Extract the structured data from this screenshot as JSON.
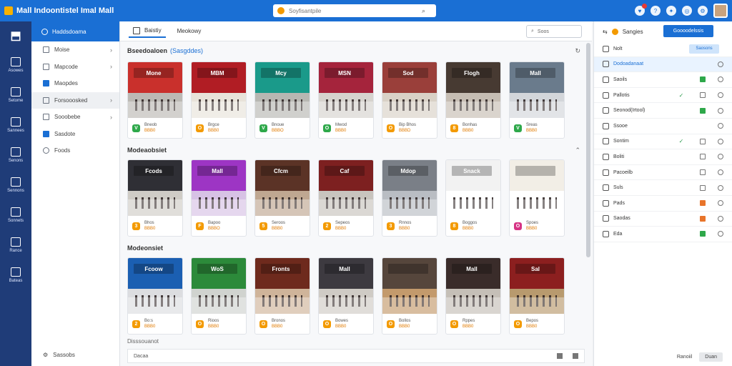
{
  "app": {
    "title": "Mall Indoontistel Imal Mall"
  },
  "search": {
    "placeholder": "Soyfisantpile"
  },
  "sidebar": {
    "header": "Haddsdoama",
    "items": [
      {
        "label": "Moise",
        "chevron": true
      },
      {
        "label": "Mapcode",
        "chevron": true
      },
      {
        "label": "Maopdes",
        "chevron": false
      },
      {
        "label": "Forsooosked",
        "chevron": true
      },
      {
        "label": "Sooobebe",
        "chevron": true
      },
      {
        "label": "Sasdote",
        "chevron": false
      },
      {
        "label": "Foods",
        "chevron": false
      }
    ],
    "footer": "Sassobs"
  },
  "rail": {
    "items": [
      "Asowes",
      "Setome",
      "Sannees",
      "Senons",
      "Sennons",
      "Sonnets",
      "Rance",
      "Bateas"
    ]
  },
  "tabs": [
    {
      "label": "Baistiy"
    },
    {
      "label": "Meokowy"
    }
  ],
  "main_search": {
    "placeholder": "Soos"
  },
  "sections": [
    {
      "title": "Bseedoaloen",
      "tag": "(Sasgddes)",
      "cards": [
        {
          "sign": "Mone",
          "line1": "Bneob",
          "line2": "BBB0",
          "badge": "V",
          "badge_color": "#2ea84a",
          "wall": "#c9302c",
          "floor": "#bcb9b4"
        },
        {
          "sign": "MBM",
          "line1": "Brgce",
          "line2": "BBB0",
          "badge": "O",
          "badge_color": "#f39a00",
          "wall": "#b11d24",
          "floor": "#e8e3da"
        },
        {
          "sign": "Mcy",
          "line1": "Bnoue",
          "line2": "BBBO",
          "badge": "V",
          "badge_color": "#2ea84a",
          "wall": "#1a9a8a",
          "floor": "#b7b7b2"
        },
        {
          "sign": "MSN",
          "line1": "Mwod",
          "line2": "BBB0",
          "badge": "O",
          "badge_color": "#2ea84a",
          "wall": "#a5243c",
          "floor": "#d6d3ce"
        },
        {
          "sign": "Sod",
          "line1": "Bip Bhos",
          "line2": "BBBD",
          "badge": "O",
          "badge_color": "#f39a00",
          "wall": "#9a3f3a",
          "floor": "#d9d1c6"
        },
        {
          "sign": "Flogh",
          "line1": "Bonhas",
          "line2": "BBB0",
          "badge": "8",
          "badge_color": "#f39a00",
          "wall": "#473a32",
          "floor": "#c6bdb3"
        },
        {
          "sign": "Mall",
          "line1": "Sreas",
          "line2": "BBB0",
          "badge": "V",
          "badge_color": "#2ea84a",
          "wall": "#6a7b8c",
          "floor": "#d3d6da"
        }
      ]
    },
    {
      "title": "Modeaobsiet",
      "tag": "",
      "cards": [
        {
          "sign": "Fcods",
          "line1": "Bhos",
          "line2": "BBB0",
          "badge": "3",
          "badge_color": "#f39a00",
          "wall": "#2f2f35",
          "floor": "#cfccc6"
        },
        {
          "sign": "Mall",
          "line1": "Bapoo",
          "line2": "BBBO",
          "badge": "F",
          "badge_color": "#f39a00",
          "wall": "#9d35c4",
          "floor": "#d7c2e5"
        },
        {
          "sign": "Cfcm",
          "line1": "Seroos",
          "line2": "BBB0",
          "badge": "5",
          "badge_color": "#f39a00",
          "wall": "#5b3326",
          "floor": "#bfa791"
        },
        {
          "sign": "Caf",
          "line1": "Sepeos",
          "line2": "BBB0",
          "badge": "2",
          "badge_color": "#f39a00",
          "wall": "#7d2020",
          "floor": "#c8c4be"
        },
        {
          "sign": "Mdop",
          "line1": "Rnnos",
          "line2": "BBB0",
          "badge": "3",
          "badge_color": "#f39a00",
          "wall": "#7a7f87",
          "floor": "#b9bdc3"
        },
        {
          "sign": "Snack",
          "line1": "Boggos",
          "line2": "BBB0",
          "badge": "8",
          "badge_color": "#f39a00",
          "wall": "#f2f2f2",
          "floor": "#ffffff"
        },
        {
          "sign": "",
          "line1": "Spoes",
          "line2": "BBB0",
          "badge": "O",
          "badge_color": "#d63384",
          "wall": "#f2eee6",
          "floor": "#ffffff"
        }
      ]
    },
    {
      "title": "Modeonsiet",
      "tag": "",
      "cards": [
        {
          "sign": "Fcoow",
          "line1": "Bo:s",
          "line2": "BBB0",
          "badge": "2",
          "badge_color": "#f39a00",
          "wall": "#1b5fb2",
          "floor": "#dcdde0"
        },
        {
          "sign": "WoS",
          "line1": "Rioos",
          "line2": "BBB0",
          "badge": "O",
          "badge_color": "#f39a00",
          "wall": "#2c8a3a",
          "floor": "#d0d3cf"
        },
        {
          "sign": "Fronts",
          "line1": "Bronos",
          "line2": "BBB0",
          "badge": "O",
          "badge_color": "#f39a00",
          "wall": "#6e2a1d",
          "floor": "#cfb49a"
        },
        {
          "sign": "Mall",
          "line1": "Bowes",
          "line2": "BBB0",
          "badge": "O",
          "badge_color": "#f39a00",
          "wall": "#3d3a40",
          "floor": "#cfcbc5"
        },
        {
          "sign": "",
          "line1": "Bollos",
          "line2": "BBB0",
          "badge": "O",
          "badge_color": "#f39a00",
          "wall": "#56463c",
          "floor": "#c39a6c"
        },
        {
          "sign": "Mall",
          "line1": "Rppes",
          "line2": "BBB0",
          "badge": "O",
          "badge_color": "#f39a00",
          "wall": "#3a2c2a",
          "floor": "#c5bfb7"
        },
        {
          "sign": "Sal",
          "line1": "Bepos",
          "line2": "BBB0",
          "badge": "O",
          "badge_color": "#f39a00",
          "wall": "#8c1f1f",
          "floor": "#b89a6e"
        }
      ]
    }
  ],
  "bottom_bar": {
    "label": "Dacaa",
    "cutoff_label": "Disssouanot"
  },
  "right_panel": {
    "title": "Sangies",
    "button": "Goooodelssis",
    "rows": [
      {
        "label": "Nolt",
        "c1": "",
        "c2": "",
        "c3": "",
        "highlight": false,
        "action": "Saosons"
      },
      {
        "label": "Dodoadanaat",
        "c1": "",
        "c2": "",
        "c3": "circ",
        "highlight": true,
        "action": ""
      },
      {
        "label": "Saoils",
        "c1": "",
        "c2": "on",
        "c3": "circ",
        "highlight": false,
        "action": ""
      },
      {
        "label": "Pallotis",
        "c1": "✓",
        "c2": "off",
        "c3": "circ",
        "highlight": false,
        "action": ""
      },
      {
        "label": "Seonod(Irtool)",
        "c1": "",
        "c2": "on",
        "c3": "circ",
        "highlight": false,
        "action": ""
      },
      {
        "label": "Ssooe",
        "c1": "",
        "c2": "",
        "c3": "circ",
        "highlight": false,
        "action": ""
      },
      {
        "label": "Sontim",
        "c1": "✓",
        "c2": "off",
        "c3": "circ",
        "highlight": false,
        "action": ""
      },
      {
        "label": "Boliti",
        "c1": "",
        "c2": "off",
        "c3": "circ",
        "highlight": false,
        "action": ""
      },
      {
        "label": "Pacoeilb",
        "c1": "",
        "c2": "off",
        "c3": "circ",
        "highlight": false,
        "action": ""
      },
      {
        "label": "Suls",
        "c1": "",
        "c2": "off",
        "c3": "circ",
        "highlight": false,
        "action": ""
      },
      {
        "label": "Pads",
        "c1": "",
        "c2": "warn",
        "c3": "circ",
        "highlight": false,
        "action": ""
      },
      {
        "label": "Saodas",
        "c1": "",
        "c2": "warn",
        "c3": "circ",
        "highlight": false,
        "action": ""
      },
      {
        "label": "Eda",
        "c1": "",
        "c2": "on",
        "c3": "circ",
        "highlight": false,
        "action": ""
      }
    ],
    "footer": {
      "link": "Ranoiil",
      "button": "Duan"
    }
  },
  "colors": {
    "accent": "#1a6fd4",
    "rail": "#1f3c78",
    "badge_green": "#2ea84a",
    "badge_orange": "#f39a00"
  }
}
